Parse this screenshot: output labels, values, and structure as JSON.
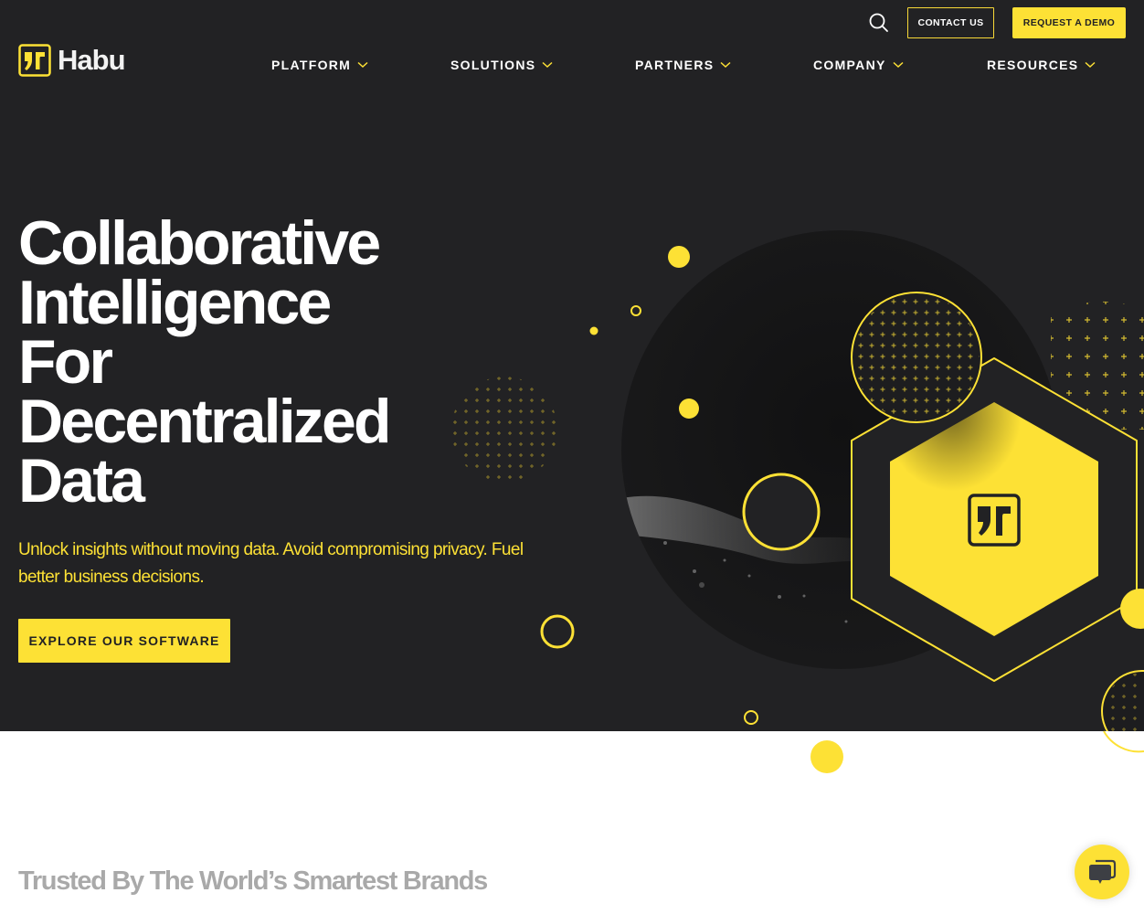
{
  "brand": {
    "name": "Habu",
    "accent_color": "#fde135",
    "background_color": "#222224"
  },
  "header": {
    "search_icon": "search-icon",
    "contact_label": "CONTACT US",
    "demo_label": "REQUEST A DEMO"
  },
  "nav": {
    "items": [
      {
        "label": "PLATFORM",
        "icon": "chevron-down-icon"
      },
      {
        "label": "SOLUTIONS",
        "icon": "chevron-down-icon"
      },
      {
        "label": "PARTNERS",
        "icon": "chevron-down-icon"
      },
      {
        "label": "COMPANY",
        "icon": "chevron-down-icon"
      },
      {
        "label": "RESOURCES",
        "icon": "chevron-down-icon"
      }
    ]
  },
  "hero": {
    "headline_lines": [
      "Collaborative",
      "Intelligence",
      "For",
      "Decentralized",
      "Data"
    ],
    "subtext": "Unlock insights without moving data. Avoid compromising privacy. Fuel better business decisions.",
    "cta_label": "EXPLORE OUR SOFTWARE"
  },
  "trusted": {
    "heading": "Trusted By The World’s Smartest Brands"
  },
  "chat": {
    "icon": "chat-bubbles-icon"
  }
}
